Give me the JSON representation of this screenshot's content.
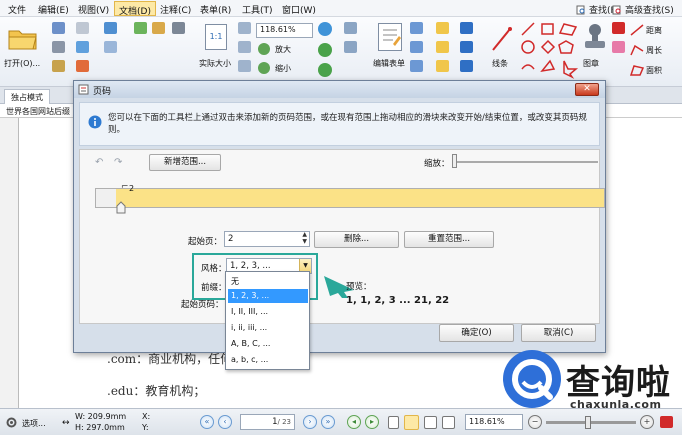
{
  "menu": {
    "items": [
      "文件",
      "编辑(E)",
      "视图(V)",
      "文档(D)",
      "注释(C)",
      "表单(R)",
      "工具(T)",
      "窗口(W)"
    ],
    "active_index": 3,
    "search_label": "查找(F)",
    "advanced_search_label": "高级查找(S)"
  },
  "ribbon": {
    "open_label": "打开(O)...",
    "actual_size_label": "实际大小",
    "zoom_value": "118.61%",
    "zoom_in_label": "放大",
    "zoom_out_label": "缩小",
    "edit_form_label": "编辑表单",
    "lines_label": "线条",
    "stamp_label": "图章",
    "distance_label": "距离",
    "perimeter_label": "周长",
    "area_label": "面积"
  },
  "tabstrip": {
    "tab_label": "独占模式",
    "doc_title": "世界各国网站后缀"
  },
  "document": {
    "line1": ".com：商业机构，任何人都可以注册；",
    "line2": ".edu：教育机构；"
  },
  "dialog": {
    "title": "页码",
    "close_label": "✕",
    "info_text": "您可以在下面的工具栏上通过双击来添加新的页码范围，或在现有范围上拖动相应的滑块来改变开始/结束位置，或改变其页码规则。",
    "new_range_label": "新增范围...",
    "zoom_label": "缩放：",
    "ruler_marker": "2",
    "start_page_label": "起始页：",
    "start_page_value": "2",
    "delete_label": "删除...",
    "reset_range_label": "重置范围...",
    "style_label": "风格：",
    "style_value": "1, 2, 3, ...",
    "prefix_label": "前缀：",
    "start_number_label": "起始页码：",
    "preview_label": "预览：",
    "preview_value": "1, 1, 2, 3 ... 21, 22",
    "ok_label": "确定(O)",
    "cancel_label": "取消(C)"
  },
  "dropdown": {
    "options": [
      "无",
      "1, 2, 3, ...",
      "I, II, III, ...",
      "i, ii, iii, ...",
      "A, B, C, ...",
      "a, b, c, ..."
    ],
    "selected_index": 1
  },
  "statusbar": {
    "options_label": "选项...",
    "width_label": "W: 209.9mm",
    "height_label": "H: 297.0mm",
    "x_label": "X:",
    "y_label": "Y:",
    "page_value": "1",
    "page_total": "/ 23",
    "zoom_value": "118.61%"
  },
  "watermark": {
    "text": "查询啦",
    "url": "chaxunla.com"
  },
  "colors": {
    "accent_highlight": "#2aa89a",
    "ruler_fill": "#fbe287",
    "selection_blue": "#3399ff",
    "watermark_blue": "#2e6fd8"
  }
}
